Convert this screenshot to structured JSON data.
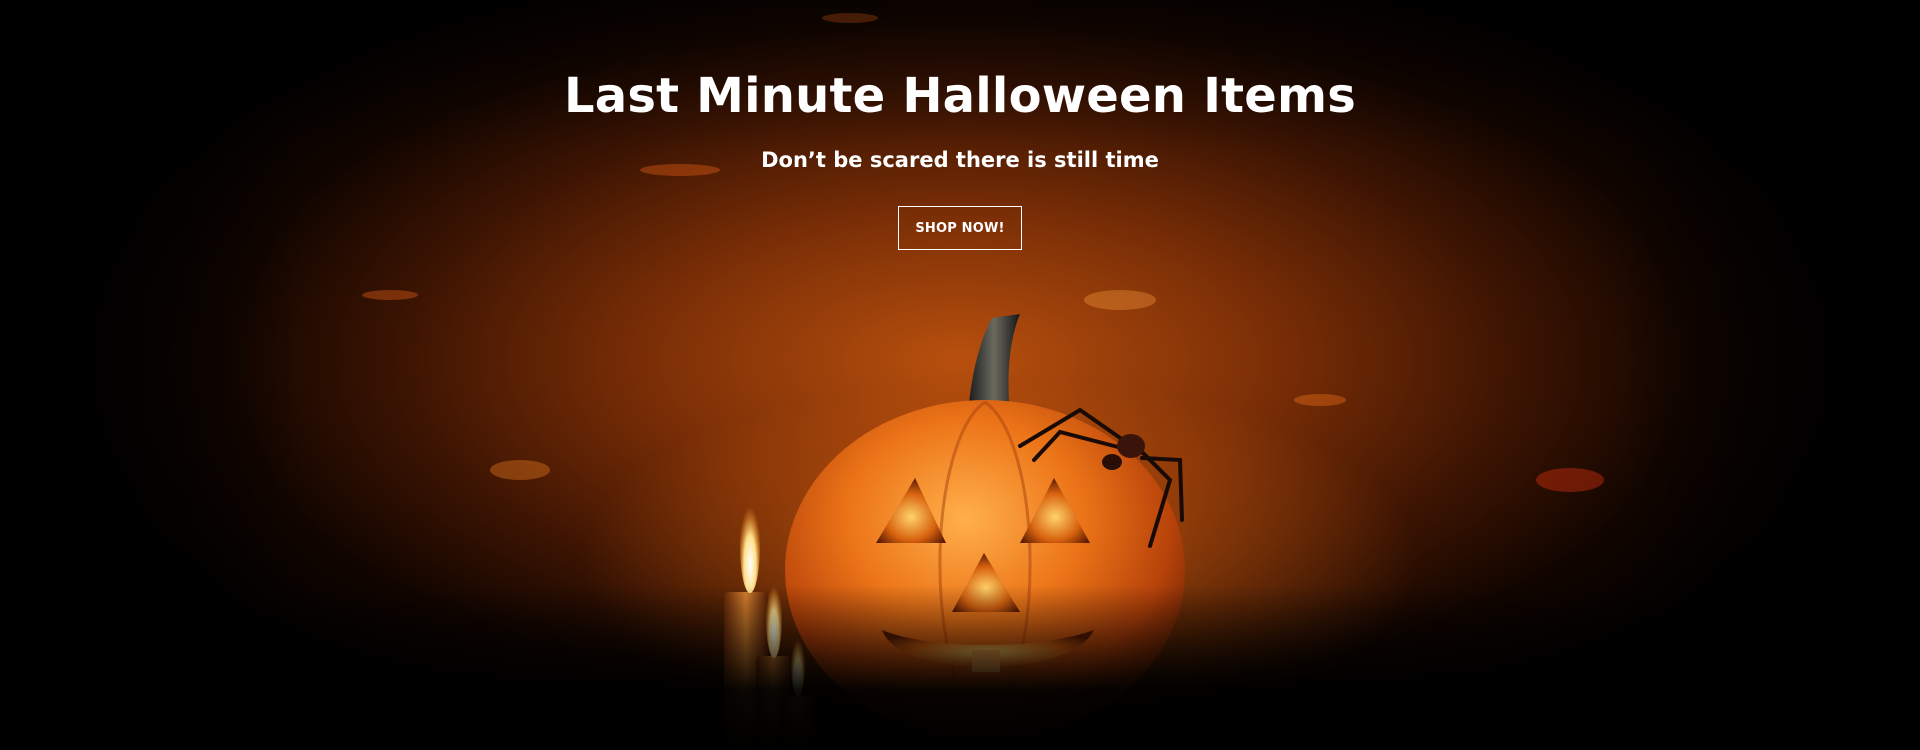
{
  "hero": {
    "title": "Last Minute Halloween Items",
    "subtitle": "Don’t be scared there is still time",
    "cta_label": "SHOP NOW!"
  },
  "colors": {
    "text": "#ffffff",
    "background_core": "#b8500e",
    "background_edge": "#000000",
    "pumpkin": "#e06a12"
  },
  "icons": {
    "pumpkin": "jack-o-lantern-icon",
    "spider": "spider-icon",
    "candle": "candle-icon"
  }
}
